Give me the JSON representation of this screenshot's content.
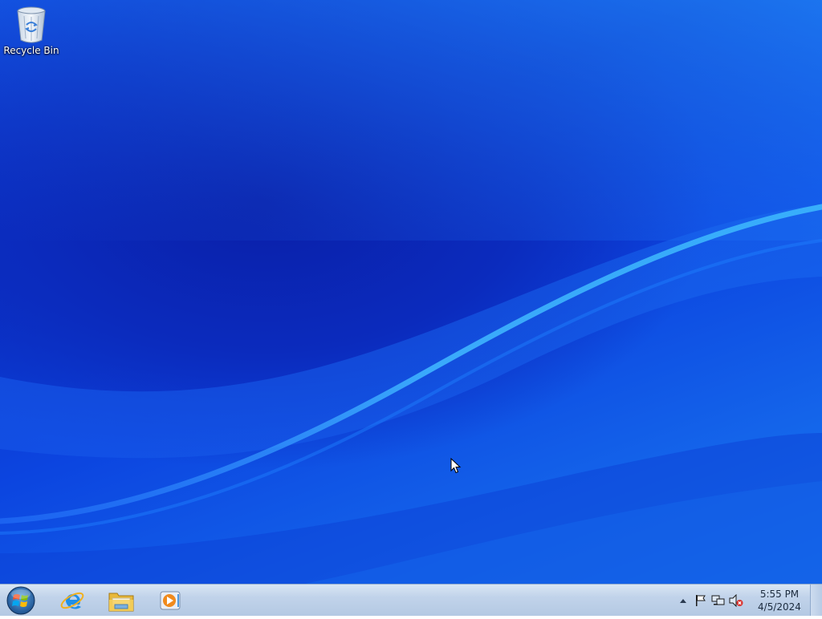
{
  "desktop": {
    "icons": [
      {
        "label": "Recycle Bin",
        "icon": "recycle-bin-icon"
      }
    ]
  },
  "taskbar": {
    "start": {
      "icon": "windows-start-orb-icon"
    },
    "pinned": [
      {
        "icon": "internet-explorer-icon"
      },
      {
        "icon": "windows-explorer-folder-icon"
      },
      {
        "icon": "media-player-icon"
      }
    ],
    "tray": {
      "icons": [
        "show-hidden-icons-arrow",
        "action-center-flag-icon",
        "network-icon",
        "volume-muted-icon"
      ],
      "time": "5:55 PM",
      "date": "4/5/2024"
    }
  },
  "colors": {
    "wallpaper_dark": "#0a1fa8",
    "wallpaper_light": "#1a7cf2",
    "taskbar": "#c1d3ea",
    "clock_text": "#1c2b3e"
  }
}
